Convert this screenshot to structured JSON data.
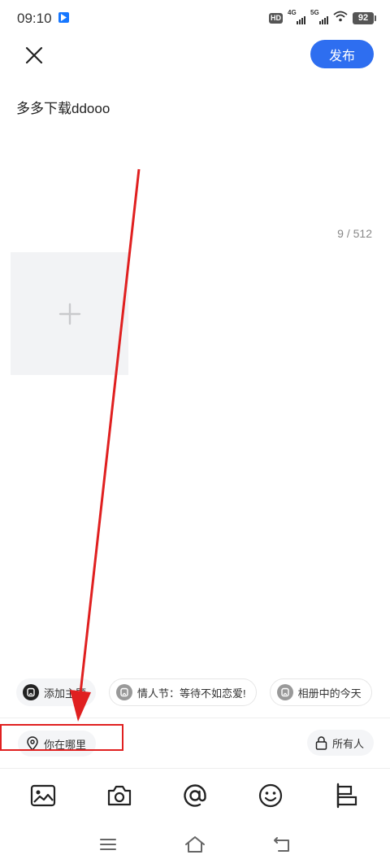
{
  "status_bar": {
    "time": "09:10",
    "hd_label": "HD",
    "signal1_label": "4G",
    "signal2_label": "5G",
    "battery": "92"
  },
  "header": {
    "close_icon": "close-icon",
    "publish_label": "发布",
    "accent_color": "#2e6ef0"
  },
  "post": {
    "text": "多多下载ddooo",
    "char_count": "9 / 512"
  },
  "media": {
    "add_icon": "plus-icon"
  },
  "topics": [
    {
      "label": "添加主题",
      "icon": "topic-icon"
    },
    {
      "label": "情人节：等待不如恋爱!",
      "icon": "topic-icon"
    },
    {
      "label": "相册中的今天",
      "icon": "topic-icon"
    }
  ],
  "location": {
    "label": "你在哪里",
    "icon": "location-pin-icon"
  },
  "visibility": {
    "label": "所有人",
    "icon": "lock-icon"
  },
  "toolbar": {
    "items": [
      "image-icon",
      "camera-icon",
      "at-icon",
      "emoji-icon",
      "layout-icon"
    ]
  },
  "annotation": {
    "color": "#e02020"
  }
}
